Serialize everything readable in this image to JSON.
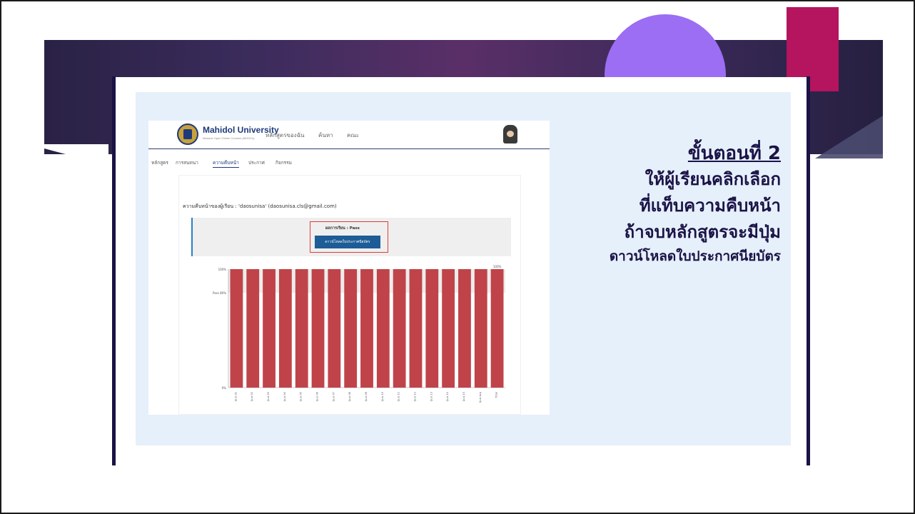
{
  "slide": {
    "colors": {
      "banner": "#3b2c5c",
      "circle": "#9b6ef3",
      "block": "#b5145e",
      "accent": "#1b1346",
      "panel": "#e6f0fb"
    }
  },
  "screenshot": {
    "header": {
      "brand": "Mahidol University",
      "brand_sub": "Massive Open Online Courses (MOOCs)",
      "nav": [
        "หลักสูตรของฉัน",
        "ค้นหา",
        "คณะ"
      ]
    },
    "subtabs": [
      "หลักสูตร",
      "การสนทนา",
      "ความคืบหน้า",
      "ประกาศ",
      "กิจกรรม"
    ],
    "active_subtab": "ความคืบหน้า",
    "progress_title": "ความคืบหน้าของผู้เรียน : 'daosunisa' (daosunisa.cls@gmail.com)",
    "result_label": "ผลการเรียน : Pass",
    "download_label": "ดาวน์โหลดใบประกาศนียบัตร"
  },
  "chart_data": {
    "type": "bar",
    "categories": [
      "Quiz 01",
      "Quiz 02",
      "Quiz 03",
      "Quiz 04",
      "Quiz 05",
      "Quiz 06",
      "Quiz 07",
      "Quiz 08",
      "Quiz 09",
      "Quiz 10",
      "Quiz 11",
      "Quiz 12",
      "Quiz 13",
      "Quiz 14",
      "Quiz 15",
      "Quiz Avg",
      "Total"
    ],
    "values": [
      100,
      100,
      100,
      100,
      100,
      100,
      100,
      100,
      100,
      100,
      100,
      100,
      100,
      100,
      100,
      100,
      100
    ],
    "yticks": [
      "100%",
      "Pass 80%",
      "0%"
    ],
    "total_label": "100%",
    "ylim": [
      0,
      100
    ],
    "bar_color": "#c0434a"
  },
  "step": {
    "title": "ขั้นตอนที่ 2",
    "lines": [
      "ให้ผู้เรียนคลิกเลือก",
      "ที่แท็บความคืบหน้า",
      "ถ้าจบหลักสูตรจะมีปุ่ม"
    ],
    "last_line": "ดาวน์โหลดใบประกาศนียบัตร"
  }
}
